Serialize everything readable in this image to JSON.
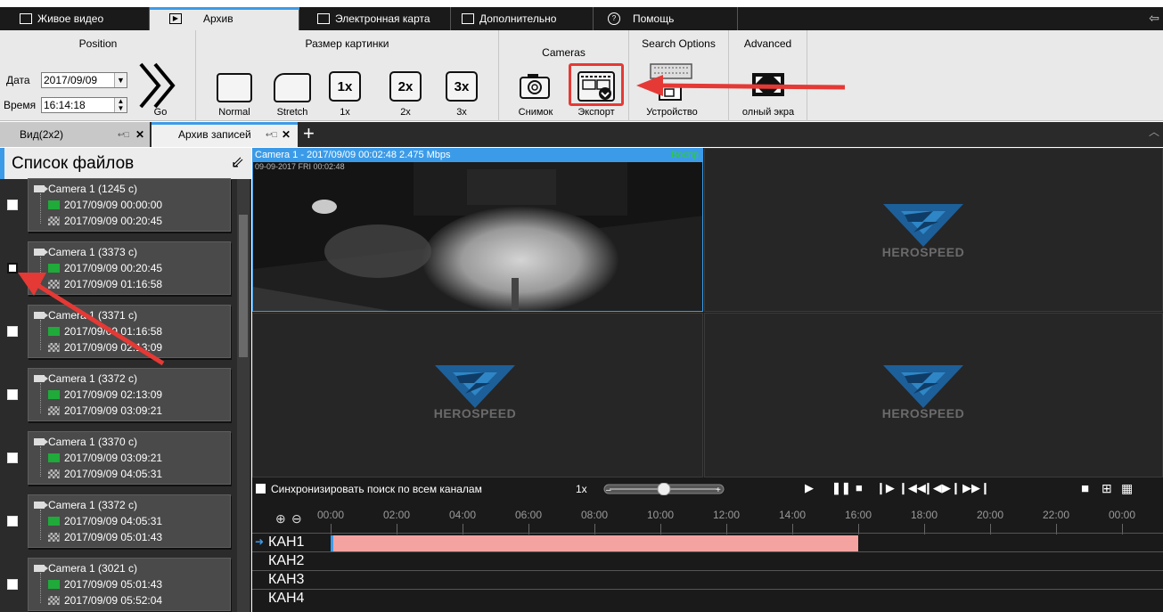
{
  "top_tabs": [
    {
      "label": "Живое видео",
      "icon": "monitor-icon"
    },
    {
      "label": "Архив",
      "icon": "play-icon"
    },
    {
      "label": "Электронная карта",
      "icon": "map-icon"
    },
    {
      "label": "Дополнительно",
      "icon": "folder-icon"
    },
    {
      "label": "Помощь",
      "icon": "help-icon"
    }
  ],
  "ribbon": {
    "position": {
      "title": "Position",
      "date_label": "Дата",
      "date_value": "2017/09/09",
      "time_label": "Время",
      "time_value": "16:14:18",
      "go_label": "Go"
    },
    "picture_size": {
      "title": "Размер картинки",
      "normal_label": "Normal",
      "stretch_label": "Stretch",
      "x1_label": "1x",
      "x2_label": "2x",
      "x3_label": "3x",
      "x1_icon": "1x",
      "x2_icon": "2x",
      "x3_icon": "3x"
    },
    "cameras": {
      "title": "Cameras",
      "snapshot_label": "Снимок",
      "export_label": "Экспорт"
    },
    "search_options": {
      "title": "Search Options",
      "device_label": "Устройство"
    },
    "advanced": {
      "title": "Advanced",
      "fullscreen_label": "олный экра"
    }
  },
  "view_tabs": [
    {
      "label": "Вид(2x2)",
      "active": false
    },
    {
      "label": "Архив записей",
      "active": true
    }
  ],
  "file_list": {
    "title": "Список файлов",
    "entries": [
      {
        "camera": "Camera 1  (1245 c)",
        "start": "2017/09/09 00:00:00",
        "end": "2017/09/09 00:20:45"
      },
      {
        "camera": "Camera 1  (3373 c)",
        "start": "2017/09/09 00:20:45",
        "end": "2017/09/09 01:16:58"
      },
      {
        "camera": "Camera 1  (3371 c)",
        "start": "2017/09/09 01:16:58",
        "end": "2017/09/09 02:13:09"
      },
      {
        "camera": "Camera 1  (3372 c)",
        "start": "2017/09/09 02:13:09",
        "end": "2017/09/09 03:09:21"
      },
      {
        "camera": "Camera 1  (3370 c)",
        "start": "2017/09/09 03:09:21",
        "end": "2017/09/09 04:05:31"
      },
      {
        "camera": "Camera 1  (3372 c)",
        "start": "2017/09/09 04:05:31",
        "end": "2017/09/09 05:01:43"
      },
      {
        "camera": "Camera 1  (3021 c)",
        "start": "2017/09/09 05:01:43",
        "end": "2017/09/09 05:52:04"
      }
    ]
  },
  "video": {
    "active_header": "Camera 1 - 2017/09/09 00:02:48  2.475 Mbps",
    "play_status": "Воспр",
    "osd_text": "09-09-2017 FRI 00:02:48",
    "logo_text": "HEROSPEED"
  },
  "playback": {
    "sync_label": "Синхронизировать поиск по всем каналам",
    "speed": "1x",
    "speed_level": 0.5,
    "ticks": [
      "00:00",
      "02:00",
      "04:00",
      "06:00",
      "08:00",
      "10:00",
      "12:00",
      "14:00",
      "16:00",
      "18:00",
      "20:00",
      "22:00",
      "00:00"
    ],
    "channels": [
      "КАН1",
      "КАН2",
      "КАН3",
      "КАН4"
    ],
    "recording_end_fraction": 0.6667
  },
  "colors": {
    "accent": "#3c9be8",
    "highlight_red": "#e53935",
    "record_bar": "#f4a3a0"
  }
}
